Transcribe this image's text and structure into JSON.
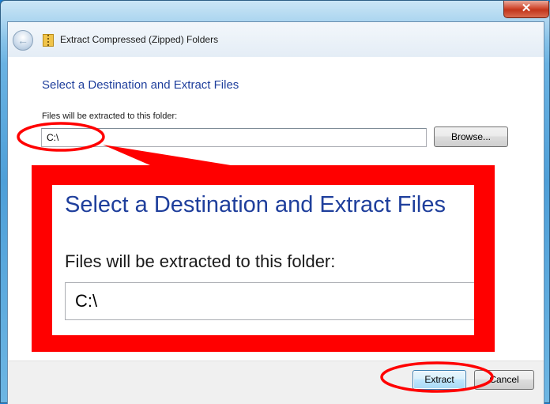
{
  "window": {
    "title": "Extract Compressed (Zipped) Folders",
    "close_glyph": "✕"
  },
  "wizard": {
    "heading": "Select a Destination and Extract Files",
    "folder_label": "Files will be extracted to this folder:",
    "path_value": "C:\\",
    "browse_label": "Browse..."
  },
  "footer": {
    "extract_label": "Extract",
    "cancel_label": "Cancel"
  },
  "zoom_callout": {
    "heading": "Select a Destination and Extract Files",
    "folder_label": "Files will be extracted to this folder:",
    "path_value": "C:\\"
  },
  "icons": {
    "back": "back-arrow-icon",
    "zip": "zip-folder-icon",
    "close": "close-icon"
  },
  "colors": {
    "heading": "#1f3f9c",
    "annotation": "#ff0000",
    "default_button": "#bee6fd"
  }
}
